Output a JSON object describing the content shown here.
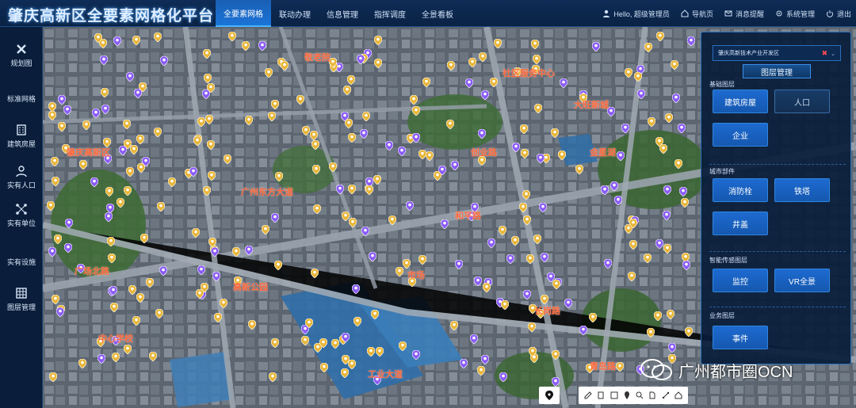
{
  "header": {
    "title": "肇庆高新区全要素网格化平台",
    "tabs": [
      {
        "label": "全要素网格",
        "active": true
      },
      {
        "label": "联动办理",
        "active": false
      },
      {
        "label": "信息管理",
        "active": false
      },
      {
        "label": "指挥调度",
        "active": false
      },
      {
        "label": "全景看板",
        "active": false
      }
    ],
    "greeting": "Hello, 超级管理员",
    "right_links": [
      "导航页",
      "消息提醒",
      "系统管理",
      "退出"
    ]
  },
  "sidebar": {
    "items": [
      {
        "label": "规划图",
        "icon": "close-x-icon"
      },
      {
        "label": "标准网格",
        "icon": "grid-icon"
      },
      {
        "label": "建筑房屋",
        "icon": "building-icon"
      },
      {
        "label": "实有人口",
        "icon": "person-icon"
      },
      {
        "label": "实有单位",
        "icon": "nodes-icon"
      },
      {
        "label": "实有设施",
        "icon": "facility-icon"
      },
      {
        "label": "图层管理",
        "icon": "layers-icon"
      }
    ]
  },
  "map": {
    "labels": [
      "肇庆高新区",
      "广州东方大道",
      "敬老院",
      "社区服务中心",
      "和平路",
      "高新公园",
      "市场",
      "大旺新城",
      "金星湖",
      "广场北路",
      "中心学校",
      "工业大道",
      "创业路",
      "青岛路",
      "长岗路"
    ]
  },
  "panel": {
    "region_select": "肇庆高新技术产业开发区",
    "title": "图层管理",
    "sections": [
      {
        "title": "基础图层",
        "buttons": [
          {
            "label": "建筑房屋",
            "active": true
          },
          {
            "label": "人口",
            "active": false
          },
          {
            "label": "企业",
            "active": true
          }
        ]
      },
      {
        "title": "城市部件",
        "buttons": [
          {
            "label": "消防栓",
            "active": true
          },
          {
            "label": "铁塔",
            "active": true
          },
          {
            "label": "井盖",
            "active": true
          }
        ]
      },
      {
        "title": "智能传感图层",
        "buttons": [
          {
            "label": "监控",
            "active": true
          },
          {
            "label": "VR全景",
            "active": true
          }
        ]
      },
      {
        "title": "业务图层",
        "buttons": [
          {
            "label": "事件",
            "active": true
          }
        ]
      }
    ]
  },
  "toolbar": {
    "tools": [
      "location-pin-icon",
      "pen-icon",
      "building-icon",
      "square-icon",
      "pin-icon",
      "search-icon",
      "file-icon",
      "link-icon",
      "home-icon"
    ]
  },
  "watermark": {
    "text": "广州都市圈OCN"
  },
  "colors": {
    "accent": "#1b74d8",
    "panel_bg": "#0a1c3a",
    "poi_yellow": "#e8b638",
    "poi_purple": "#8b5cf6",
    "label_orange": "#ff6a3d"
  }
}
